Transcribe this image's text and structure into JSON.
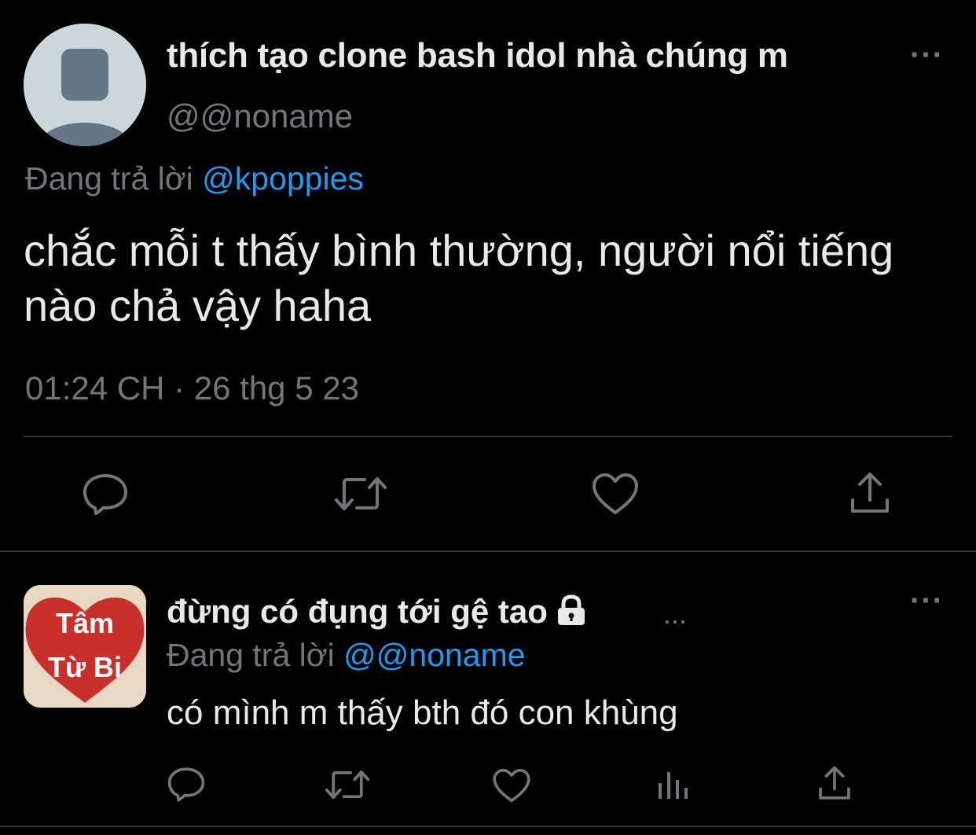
{
  "main_tweet": {
    "display_name": "thích tạo clone bash idol nhà chúng m",
    "handle": "@@noname",
    "reply_prefix": "Đang trả lời",
    "reply_mention": "@kpoppies",
    "text": "chắc mỗi t thấy bình thường, người nổi tiếng nào chả vậy haha",
    "timestamp": "01:24 CH · 26 thg 5 23",
    "more_label": "···"
  },
  "reply_tweet": {
    "display_name": "đừng có đụng tới gệ tao",
    "truncation": "...",
    "avatar_line1": "Tâm",
    "avatar_line2": "Từ Bi",
    "reply_prefix": "Đang trả lời",
    "reply_mention": "@@noname",
    "text": "có mình m thấy bth đó con khùng",
    "more_label": "···"
  },
  "icons": {
    "main_actions": [
      "reply-icon",
      "retweet-icon",
      "like-icon",
      "share-icon"
    ],
    "reply_actions": [
      "reply-icon",
      "retweet-icon",
      "like-icon",
      "analytics-icon",
      "share-icon"
    ],
    "lock": "lock-icon"
  },
  "colors": {
    "background": "#000000",
    "text_primary": "#e7e9ea",
    "text_secondary": "#71767b",
    "accent": "#1d9bf0",
    "divider": "#2f3336"
  }
}
